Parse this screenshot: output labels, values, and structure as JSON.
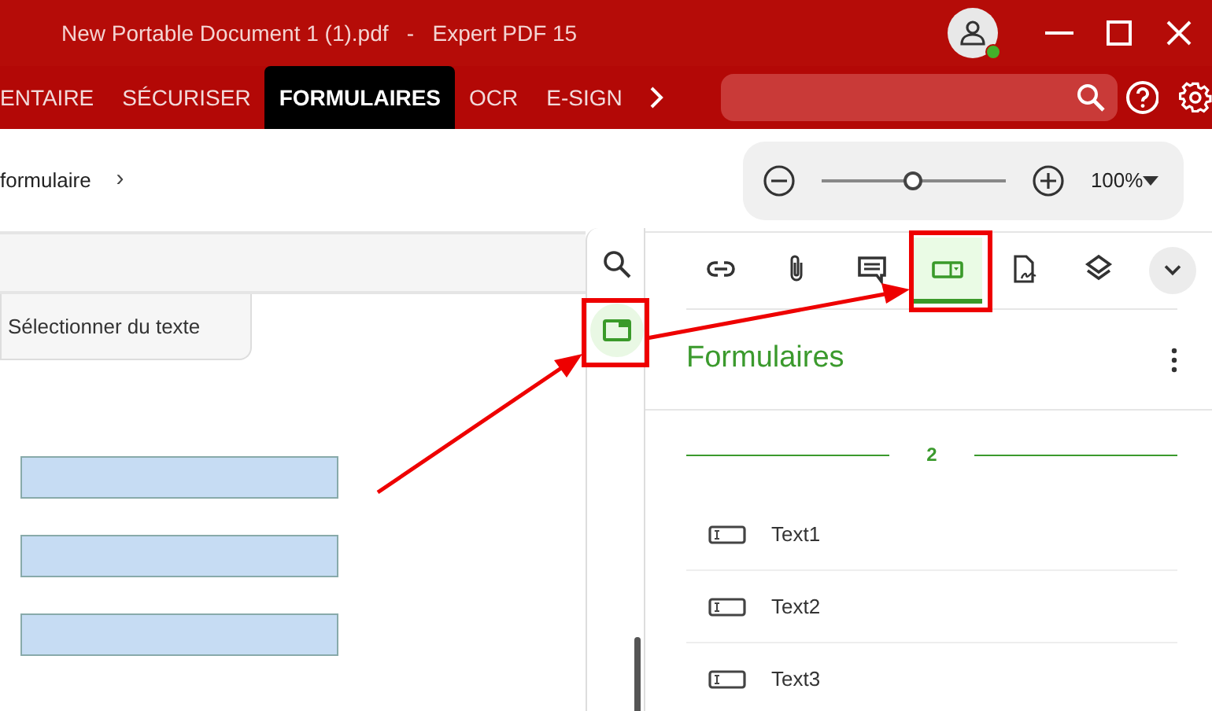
{
  "window": {
    "title": "New Portable Document 1 (1).pdf   -   Expert PDF 15",
    "user_online": true
  },
  "ribbon_tabs": [
    {
      "label": "ENTAIRE",
      "selected": false
    },
    {
      "label": "SÉCURISER",
      "selected": false
    },
    {
      "label": "FORMULAIRES",
      "selected": true
    },
    {
      "label": "OCR",
      "selected": false
    },
    {
      "label": "E-SIGN",
      "selected": false
    }
  ],
  "breadcrumb": {
    "label": "formulaire",
    "separator": "›"
  },
  "zoom": {
    "level": 0.5,
    "reading": "100%"
  },
  "document": {
    "tool_label": "Sélectionner du texte"
  },
  "side_tools": [
    {
      "kind": "search",
      "selected": false
    },
    {
      "kind": "form",
      "selected": true
    }
  ],
  "panel": {
    "tools": [
      {
        "kind": "link",
        "selected": false
      },
      {
        "kind": "attachment",
        "selected": false
      },
      {
        "kind": "comment",
        "selected": false
      },
      {
        "kind": "form",
        "selected": true
      },
      {
        "kind": "signature",
        "selected": false
      },
      {
        "kind": "layers",
        "selected": false
      },
      {
        "kind": "more"
      }
    ],
    "title": "Formulaires",
    "page_groups": [
      {
        "label": "2",
        "fields": [
          {
            "name": "Text1"
          },
          {
            "name": "Text2"
          },
          {
            "name": "Text3"
          }
        ]
      }
    ]
  }
}
